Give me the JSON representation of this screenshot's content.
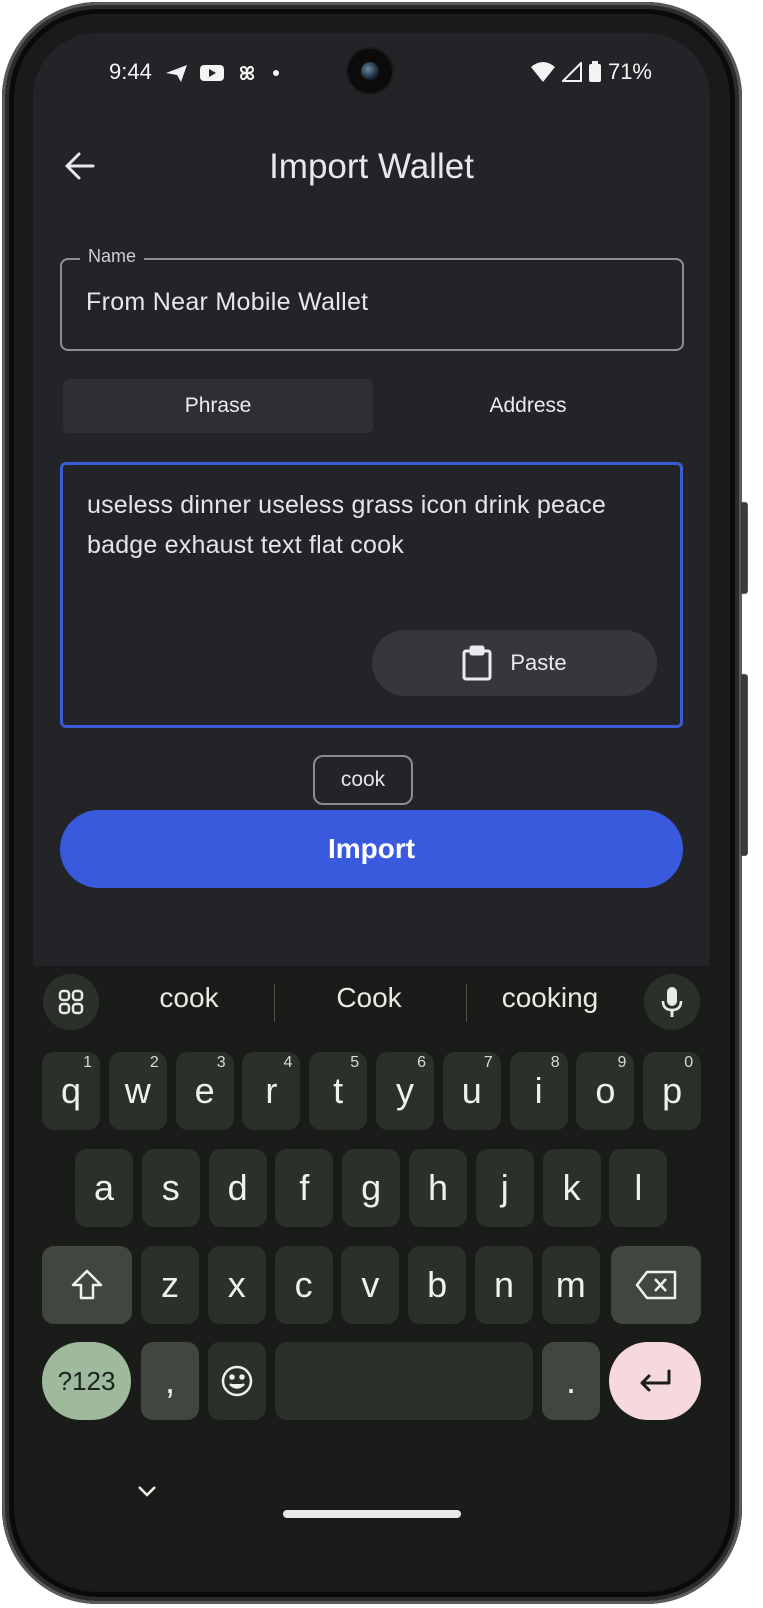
{
  "status_bar": {
    "time": "9:44",
    "left_icons": [
      "telegram-icon",
      "youtube-icon",
      "pinwheel-icon",
      "dot-icon"
    ],
    "right_icons": [
      "wifi-icon",
      "cellular-icon",
      "battery-icon"
    ],
    "battery": "71%"
  },
  "app_bar": {
    "back_icon": "arrow-left-icon",
    "title": "Import Wallet"
  },
  "name_field": {
    "label": "Name",
    "value": "From Near Mobile Wallet"
  },
  "tabs": [
    {
      "label": "Phrase",
      "active": true
    },
    {
      "label": "Address",
      "active": false
    }
  ],
  "phrase_input": {
    "value": "useless dinner useless grass icon drink peace badge exhaust text flat cook",
    "paste_icon": "clipboard-icon",
    "paste_label": "Paste"
  },
  "word_chip": {
    "label": "cook"
  },
  "import_button": {
    "label": "Import"
  },
  "keyboard": {
    "suggestions": [
      "cook",
      "Cook",
      "cooking"
    ],
    "row1": [
      {
        "k": "q",
        "h": "1"
      },
      {
        "k": "w",
        "h": "2"
      },
      {
        "k": "e",
        "h": "3"
      },
      {
        "k": "r",
        "h": "4"
      },
      {
        "k": "t",
        "h": "5"
      },
      {
        "k": "y",
        "h": "6"
      },
      {
        "k": "u",
        "h": "7"
      },
      {
        "k": "i",
        "h": "8"
      },
      {
        "k": "o",
        "h": "9"
      },
      {
        "k": "p",
        "h": "0"
      }
    ],
    "row2": [
      "a",
      "s",
      "d",
      "f",
      "g",
      "h",
      "j",
      "k",
      "l"
    ],
    "row3": [
      "z",
      "x",
      "c",
      "v",
      "b",
      "n",
      "m"
    ],
    "row4": {
      "symbols": "?123",
      "comma": ",",
      "period": "."
    },
    "icons": {
      "apps": "grid-icon",
      "mic": "microphone-icon",
      "shift": "shift-icon",
      "backspace": "backspace-icon",
      "emoji": "emoji-icon",
      "enter": "enter-icon",
      "hide": "chevron-down-icon"
    }
  },
  "colors": {
    "accent": "#3a5ade",
    "focus_border": "#3c5bd6",
    "background": "#232428",
    "keyboard_bg": "#191c18",
    "symbols_key": "#9fb99c",
    "enter_key": "#f6d9dc"
  }
}
